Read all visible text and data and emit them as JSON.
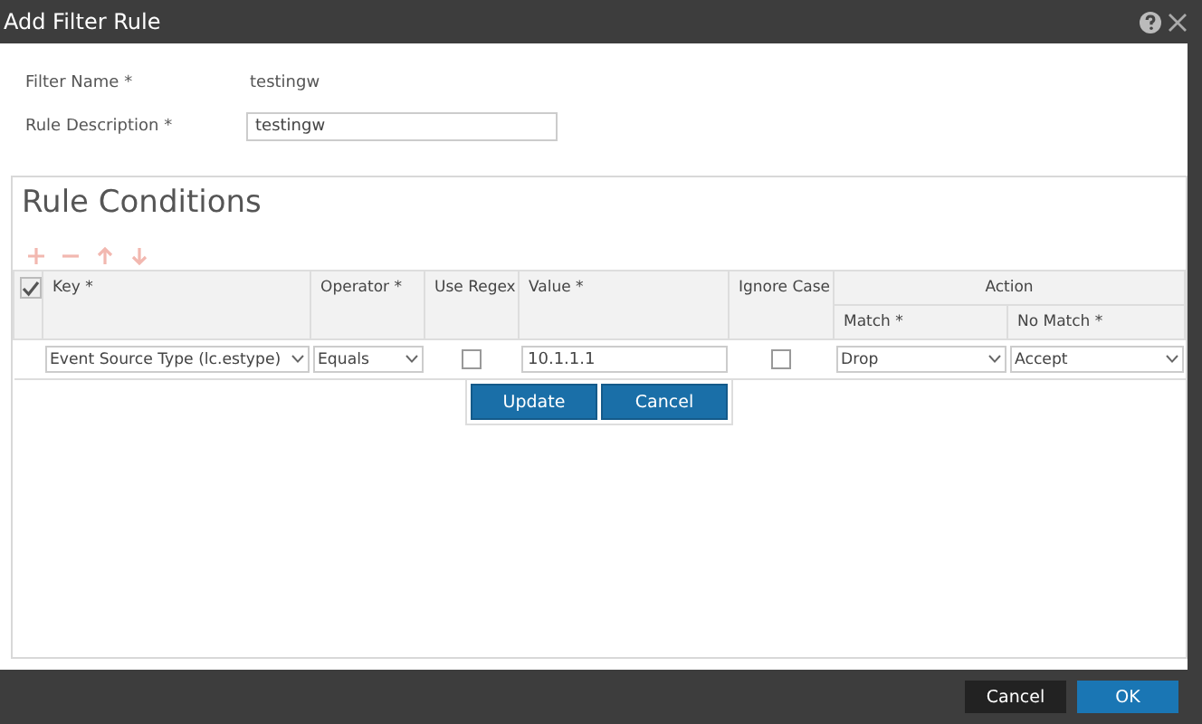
{
  "window": {
    "title": "Add Filter Rule"
  },
  "fields": [
    {
      "label": "Filter Name *",
      "value": "testingw",
      "kind": "text"
    },
    {
      "label": "Rule Description *",
      "value": "testingw",
      "kind": "input"
    }
  ],
  "rule_conditions": {
    "title": "Rule Conditions",
    "toolbar": [
      {
        "kind": "add",
        "disabled": true
      },
      {
        "kind": "remove",
        "disabled": true
      },
      {
        "kind": "up",
        "disabled": true
      },
      {
        "kind": "down",
        "disabled": true
      }
    ],
    "select_all_checked": true,
    "columns": {
      "key": "Key *",
      "operator": "Operator *",
      "use_regex": "Use Regex",
      "value": "Value *",
      "ignore_case": "Ignore Case",
      "action": "Action",
      "match": "Match *",
      "no_match": "No Match *"
    },
    "rows": [
      {
        "key": "Event Source Type (lc.estype)",
        "operator": "Equals",
        "use_regex": false,
        "value": "10.1.1.1",
        "ignore_case": false,
        "match": "Drop",
        "no_match": "Accept"
      }
    ],
    "row_buttons": [
      "Update",
      "Cancel"
    ]
  },
  "footer_buttons": [
    {
      "label": "Cancel",
      "kind": "secondary"
    },
    {
      "label": "OK",
      "kind": "primary"
    }
  ]
}
